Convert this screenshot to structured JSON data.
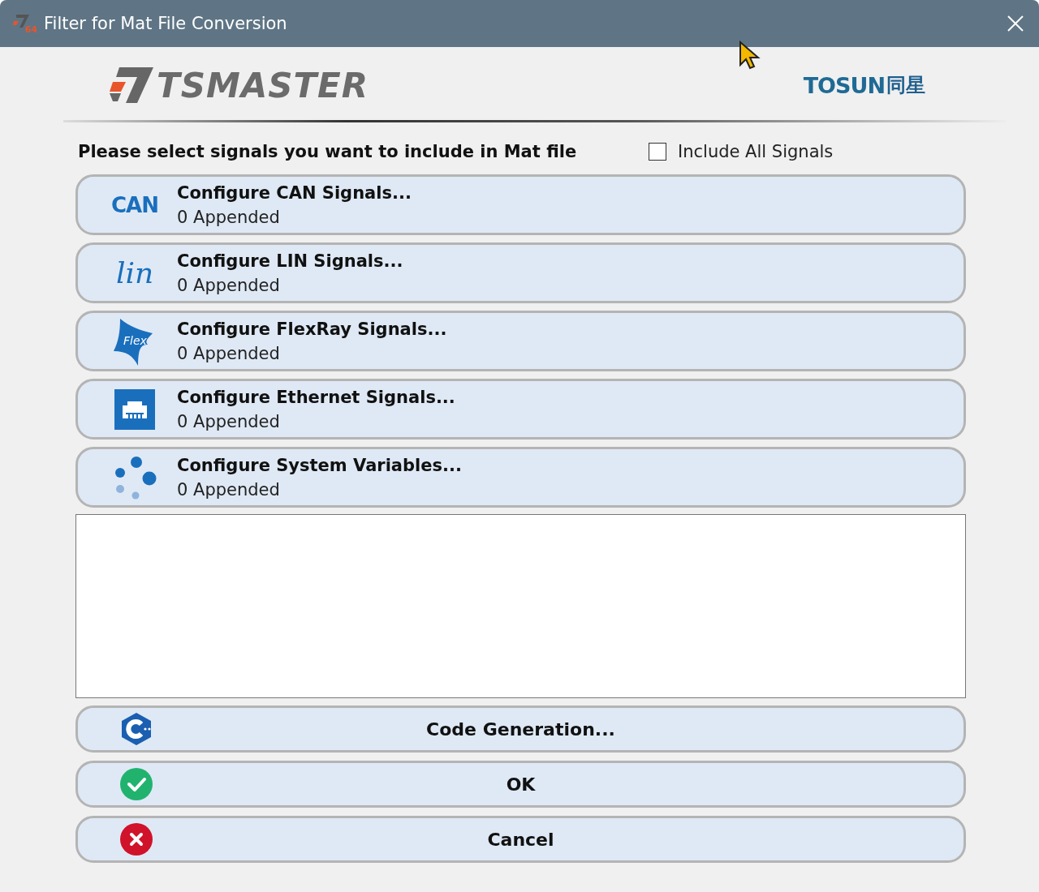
{
  "window": {
    "title": "Filter for Mat File Conversion",
    "app_icon_text": "64"
  },
  "header": {
    "product_logo": "TSMASTER",
    "company_logo_latin": "TOSUN",
    "company_logo_cjk": "同星"
  },
  "prompt": "Please select signals you want to include in Mat file",
  "include_all": {
    "label": "Include All Signals",
    "checked": false
  },
  "signal_buttons": [
    {
      "kind": "can",
      "icon_text": "CAN",
      "title": "Configure CAN Signals...",
      "count": "0 Appended"
    },
    {
      "kind": "lin",
      "icon_text": "lin",
      "title": "Configure LIN Signals...",
      "count": "0 Appended"
    },
    {
      "kind": "flexray",
      "icon_text": "Flex",
      "title": "Configure FlexRay Signals...",
      "count": "0 Appended"
    },
    {
      "kind": "ethernet",
      "title": "Configure Ethernet Signals...",
      "count": "0 Appended"
    },
    {
      "kind": "sysvar",
      "title": "Configure System Variables...",
      "count": "0 Appended"
    }
  ],
  "action_buttons": [
    {
      "kind": "code",
      "label": "Code Generation..."
    },
    {
      "kind": "ok",
      "label": "OK"
    },
    {
      "kind": "cancel",
      "label": "Cancel"
    }
  ]
}
